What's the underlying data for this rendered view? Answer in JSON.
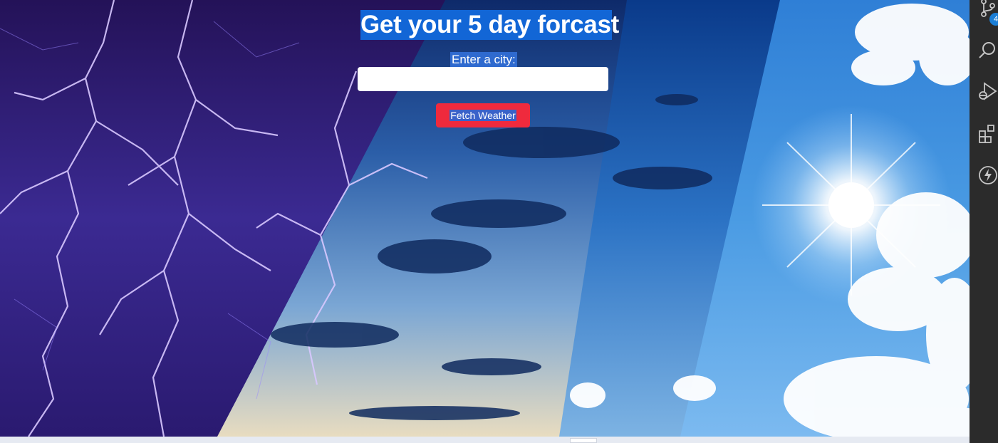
{
  "page": {
    "title": "Get your 5 day forcast",
    "city_label": "Enter a city:",
    "city_input_value": "",
    "fetch_button_label": "Fetch Weather"
  },
  "activity_bar": {
    "icons": [
      "source-control-icon",
      "search-icon",
      "run-debug-icon",
      "extensions-icon",
      "lightning-icon"
    ],
    "source_control_badge": "4"
  },
  "colors": {
    "title_highlight": "#1266d6",
    "button": "#ef2a3d",
    "activity_bar": "#2b2b2b",
    "badge": "#1a7ed6"
  }
}
